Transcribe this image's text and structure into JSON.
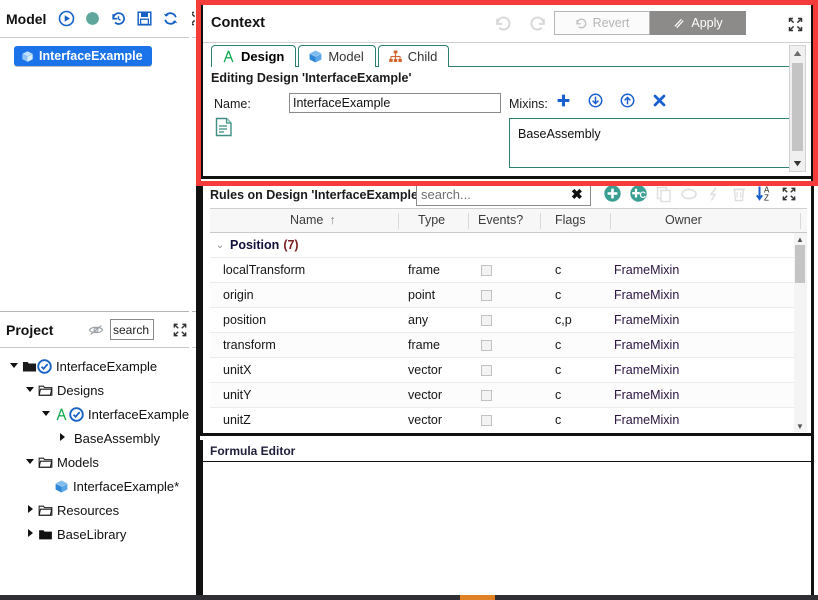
{
  "model_panel": {
    "title": "Model",
    "toolbar": [
      {
        "name": "run-icon",
        "label": "Run"
      },
      {
        "name": "status-dot-icon",
        "label": "Status"
      },
      {
        "name": "history-icon",
        "label": "History"
      },
      {
        "name": "save-icon",
        "label": "Save"
      },
      {
        "name": "refresh-icon",
        "label": "Refresh"
      },
      {
        "name": "expand-icon",
        "label": "Expand"
      }
    ],
    "chip_label": "InterfaceExample"
  },
  "project_panel": {
    "title": "Project",
    "eye_icon": "hidden-eye-icon",
    "search_value": "search",
    "search_placeholder": "search",
    "expand_icon": "expand-icon",
    "tree": [
      {
        "depth": 0,
        "twisty": "down",
        "icon": "folder-open-icon",
        "badge": "check-circle-icon",
        "label": "InterfaceExample"
      },
      {
        "depth": 1,
        "twisty": "down",
        "icon": "folder-outline-icon",
        "badge": "",
        "label": "Designs"
      },
      {
        "depth": 2,
        "twisty": "down",
        "icon": "design-a-icon",
        "badge": "check-circle-icon",
        "label": "InterfaceExample"
      },
      {
        "depth": 3,
        "twisty": "right",
        "icon": "",
        "badge": "",
        "label": "BaseAssembly"
      },
      {
        "depth": 1,
        "twisty": "down",
        "icon": "folder-outline-icon",
        "badge": "",
        "label": "Models"
      },
      {
        "depth": 2,
        "twisty": "none",
        "icon": "cube-icon",
        "badge": "",
        "label": "InterfaceExample*"
      },
      {
        "depth": 1,
        "twisty": "right",
        "icon": "folder-outline-icon",
        "badge": "",
        "label": "Resources"
      },
      {
        "depth": 1,
        "twisty": "right",
        "icon": "folder-solid-icon",
        "badge": "",
        "label": "BaseLibrary"
      }
    ]
  },
  "context_panel": {
    "title": "Context",
    "undo_icon": "undo-icon",
    "redo_icon": "redo-icon",
    "revert_label": "Revert",
    "apply_label": "Apply",
    "expand_icon": "expand-icon",
    "tabs": [
      {
        "label": "Design",
        "icon": "design-a-icon",
        "active": true
      },
      {
        "label": "Model",
        "icon": "cube-icon",
        "active": false
      },
      {
        "label": "Child",
        "icon": "hierarchy-icon",
        "active": false
      }
    ],
    "editing_line": "Editing Design 'InterfaceExample'",
    "name_label": "Name:",
    "name_value": "InterfaceExample",
    "description_icon": "document-icon",
    "mixins_label": "Mixins:",
    "mixins_tools": [
      {
        "name": "add-mixin-icon",
        "label": "Add"
      },
      {
        "name": "move-down-icon",
        "label": "Move down"
      },
      {
        "name": "move-up-icon",
        "label": "Move up"
      },
      {
        "name": "remove-mixin-icon",
        "label": "Remove"
      }
    ],
    "mixins": [
      "BaseAssembly"
    ]
  },
  "rules_panel": {
    "title": "Rules on Design 'InterfaceExample'",
    "search_value": "search...",
    "search_placeholder": "search...",
    "clear_icon": "clear-x-icon",
    "tools": [
      {
        "name": "add-rule-icon",
        "label": "Add rule",
        "enabled": true
      },
      {
        "name": "add-child-rule-icon",
        "label": "Add child rule",
        "enabled": true
      },
      {
        "name": "copy-icon",
        "label": "Copy",
        "enabled": false
      },
      {
        "name": "paste-icon",
        "label": "Paste",
        "enabled": false
      },
      {
        "name": "cut-icon",
        "label": "Cut",
        "enabled": false
      },
      {
        "name": "delete-icon",
        "label": "Delete",
        "enabled": false
      },
      {
        "name": "sort-az-icon",
        "label": "Sort A-Z",
        "enabled": true
      },
      {
        "name": "expand-icon",
        "label": "Expand",
        "enabled": true
      }
    ],
    "columns": [
      "Name",
      "Type",
      "Events?",
      "Flags",
      "Owner"
    ],
    "sort_indicator": "↑",
    "groups": [
      {
        "name": "Position",
        "count": "(7)",
        "expanded": true,
        "rows": [
          {
            "name": "localTransform",
            "type": "frame",
            "events": false,
            "flags": "c",
            "owner": "FrameMixin"
          },
          {
            "name": "origin",
            "type": "point",
            "events": false,
            "flags": "c",
            "owner": "FrameMixin"
          },
          {
            "name": "position",
            "type": "any",
            "events": false,
            "flags": "c,p",
            "owner": "FrameMixin"
          },
          {
            "name": "transform",
            "type": "frame",
            "events": false,
            "flags": "c",
            "owner": "FrameMixin"
          },
          {
            "name": "unitX",
            "type": "vector",
            "events": false,
            "flags": "c",
            "owner": "FrameMixin"
          },
          {
            "name": "unitY",
            "type": "vector",
            "events": false,
            "flags": "c",
            "owner": "FrameMixin"
          },
          {
            "name": "unitZ",
            "type": "vector",
            "events": false,
            "flags": "c",
            "owner": "FrameMixin"
          }
        ]
      }
    ]
  },
  "formula_panel": {
    "title": "Formula Editor",
    "content": ""
  },
  "colors": {
    "highlight_border": "#f63b3b",
    "accent_blue": "#1a73e8",
    "accent_teal": "#2d7f72",
    "apply_bg": "#8d8a8a",
    "status_orange": "#e08224"
  }
}
